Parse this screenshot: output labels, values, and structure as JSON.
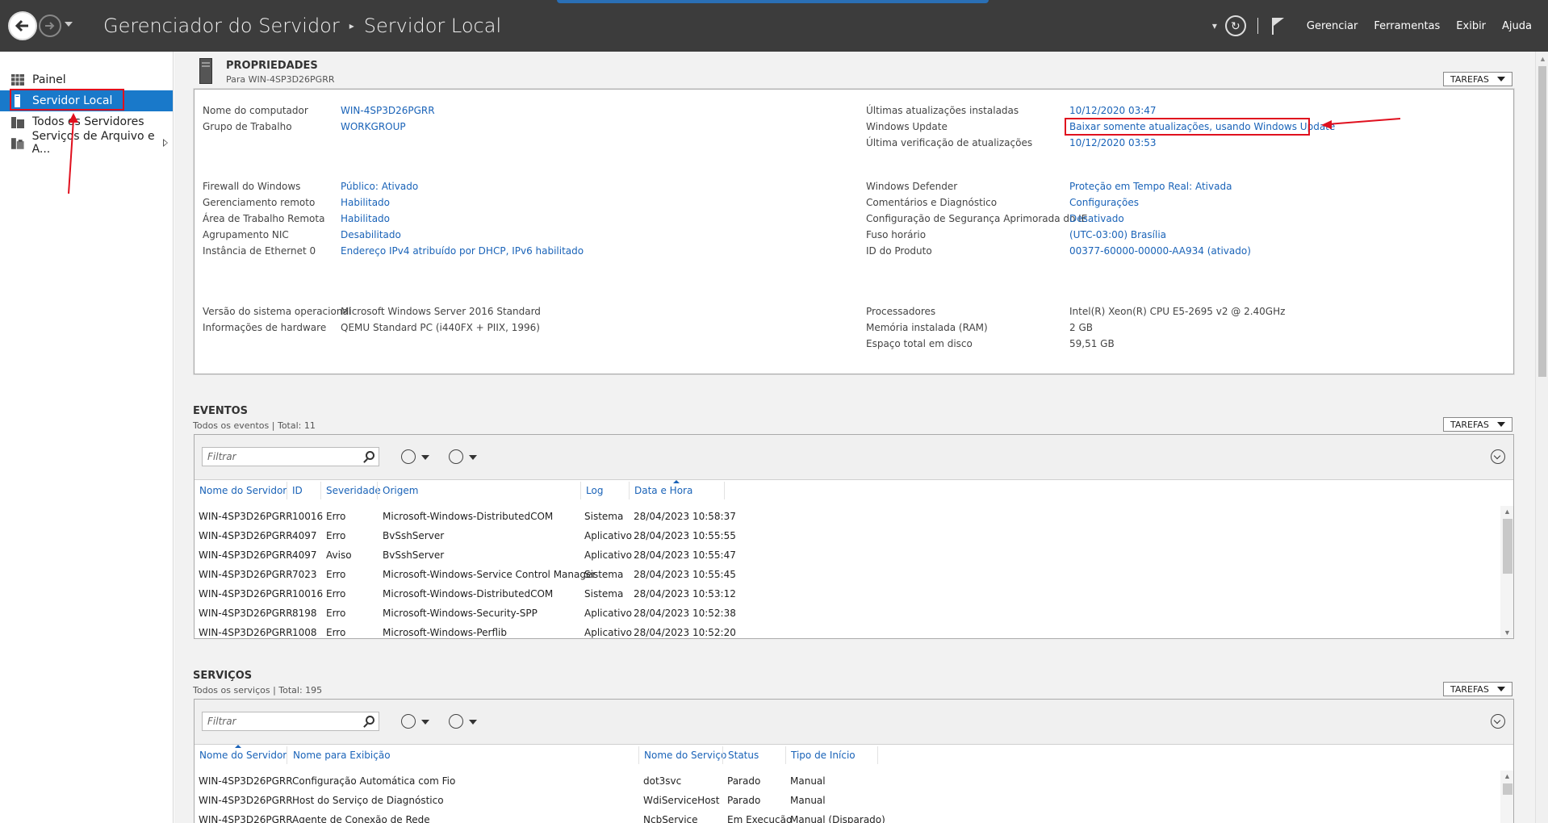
{
  "titlebar": {
    "breadcrumb_root": "Gerenciador do Servidor",
    "breadcrumb_current": "Servidor Local",
    "menu": [
      "Gerenciar",
      "Ferramentas",
      "Exibir",
      "Ajuda"
    ]
  },
  "sidebar": {
    "items": [
      {
        "label": "Painel",
        "icon": "dashboard-icon"
      },
      {
        "label": "Servidor Local",
        "icon": "server-icon",
        "active": true
      },
      {
        "label": "Todos os Servidores",
        "icon": "servers-icon"
      },
      {
        "label": "Serviços de Arquivo e A...",
        "icon": "file-services-icon"
      }
    ]
  },
  "properties": {
    "title": "PROPRIEDADES",
    "subtitle": "Para WIN-4SP3D26PGRR",
    "tasks_label": "TAREFAS",
    "left": [
      {
        "label": "Nome do computador",
        "value": "WIN-4SP3D26PGRR"
      },
      {
        "label": "Grupo de Trabalho",
        "value": "WORKGROUP"
      },
      {
        "label": "Firewall do Windows",
        "value": "Público: Ativado"
      },
      {
        "label": "Gerenciamento remoto",
        "value": "Habilitado"
      },
      {
        "label": "Área de Trabalho Remota",
        "value": "Habilitado"
      },
      {
        "label": "Agrupamento NIC",
        "value": "Desabilitado"
      },
      {
        "label": "Instância de Ethernet 0",
        "value": "Endereço IPv4 atribuído por DHCP, IPv6 habilitado"
      },
      {
        "label": "Versão do sistema operacional",
        "value": "Microsoft Windows Server 2016 Standard"
      },
      {
        "label": "Informações de hardware",
        "value": "QEMU Standard PC (i440FX + PIIX, 1996)"
      }
    ],
    "right": [
      {
        "label": "Últimas atualizações instaladas",
        "value": "10/12/2020 03:47"
      },
      {
        "label": "Windows Update",
        "value": "Baixar somente atualizações, usando Windows Update"
      },
      {
        "label": "Última verificação de atualizações",
        "value": "10/12/2020 03:53"
      },
      {
        "label": "Windows Defender",
        "value": "Proteção em Tempo Real: Ativada"
      },
      {
        "label": "Comentários e Diagnóstico",
        "value": "Configurações"
      },
      {
        "label": "Configuração de Segurança Aprimorada do IE",
        "value": "Desativado"
      },
      {
        "label": "Fuso horário",
        "value": "(UTC-03:00) Brasília"
      },
      {
        "label": "ID do Produto",
        "value": "00377-60000-00000-AA934 (ativado)"
      },
      {
        "label": "Processadores",
        "value": "Intel(R) Xeon(R) CPU E5-2695 v2 @ 2.40GHz"
      },
      {
        "label": "Memória instalada (RAM)",
        "value": "2 GB"
      },
      {
        "label": "Espaço total em disco",
        "value": "59,51 GB"
      }
    ]
  },
  "events": {
    "title": "EVENTOS",
    "subtitle": "Todos os eventos | Total: 11",
    "tasks_label": "TAREFAS",
    "filter_placeholder": "Filtrar",
    "columns": [
      "Nome do Servidor",
      "ID",
      "Severidade",
      "Origem",
      "Log",
      "Data e Hora"
    ],
    "rows": [
      [
        "WIN-4SP3D26PGRR",
        "10016",
        "Erro",
        "Microsoft-Windows-DistributedCOM",
        "Sistema",
        "28/04/2023 10:58:37"
      ],
      [
        "WIN-4SP3D26PGRR",
        "4097",
        "Erro",
        "BvSshServer",
        "Aplicativo",
        "28/04/2023 10:55:55"
      ],
      [
        "WIN-4SP3D26PGRR",
        "4097",
        "Aviso",
        "BvSshServer",
        "Aplicativo",
        "28/04/2023 10:55:47"
      ],
      [
        "WIN-4SP3D26PGRR",
        "7023",
        "Erro",
        "Microsoft-Windows-Service Control Manager",
        "Sistema",
        "28/04/2023 10:55:45"
      ],
      [
        "WIN-4SP3D26PGRR",
        "10016",
        "Erro",
        "Microsoft-Windows-DistributedCOM",
        "Sistema",
        "28/04/2023 10:53:12"
      ],
      [
        "WIN-4SP3D26PGRR",
        "8198",
        "Erro",
        "Microsoft-Windows-Security-SPP",
        "Aplicativo",
        "28/04/2023 10:52:38"
      ],
      [
        "WIN-4SP3D26PGRR",
        "1008",
        "Erro",
        "Microsoft-Windows-Perflib",
        "Aplicativo",
        "28/04/2023 10:52:20"
      ]
    ]
  },
  "services": {
    "title": "SERVIÇOS",
    "subtitle": "Todos os serviços | Total: 195",
    "tasks_label": "TAREFAS",
    "filter_placeholder": "Filtrar",
    "columns": [
      "Nome do Servidor",
      "Nome para Exibição",
      "Nome do Serviço",
      "Status",
      "Tipo de Início"
    ],
    "rows": [
      [
        "WIN-4SP3D26PGRR",
        "Configuração Automática com Fio",
        "dot3svc",
        "Parado",
        "Manual"
      ],
      [
        "WIN-4SP3D26PGRR",
        "Host do Serviço de Diagnóstico",
        "WdiServiceHost",
        "Parado",
        "Manual"
      ],
      [
        "WIN-4SP3D26PGRR",
        "Agente de Conexão de Rede",
        "NcbService",
        "Em Execução",
        "Manual (Disparado)"
      ]
    ]
  },
  "colors": {
    "accent": "#1979ca",
    "link": "#1a63b8",
    "titlebar": "#3c3c3c",
    "annotation": "#e0101e"
  }
}
